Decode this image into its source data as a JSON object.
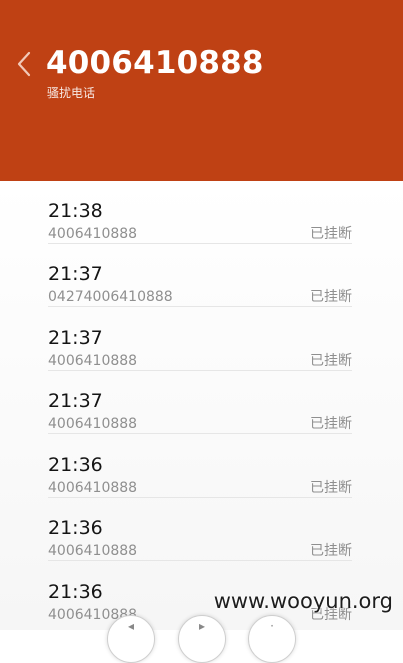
{
  "header": {
    "phone_number": "4006410888",
    "label": "骚扰电话",
    "background_color": "#bf4114",
    "back_icon": "chevron-left-icon"
  },
  "calls": [
    {
      "time": "21:38",
      "number": "4006410888",
      "status": "已挂断"
    },
    {
      "time": "21:37",
      "number": "04274006410888",
      "status": "已挂断"
    },
    {
      "time": "21:37",
      "number": "4006410888",
      "status": "已挂断"
    },
    {
      "time": "21:37",
      "number": "4006410888",
      "status": "已挂断"
    },
    {
      "time": "21:36",
      "number": "4006410888",
      "status": "已挂断"
    },
    {
      "time": "21:36",
      "number": "4006410888",
      "status": "已挂断"
    },
    {
      "time": "21:36",
      "number": "4006410888",
      "status": "已挂断"
    }
  ],
  "watermark": "www.wooyun.org",
  "bottom_controls": [
    {
      "icon": "previous-icon"
    },
    {
      "icon": "play-icon"
    },
    {
      "icon": "more-icon"
    }
  ]
}
